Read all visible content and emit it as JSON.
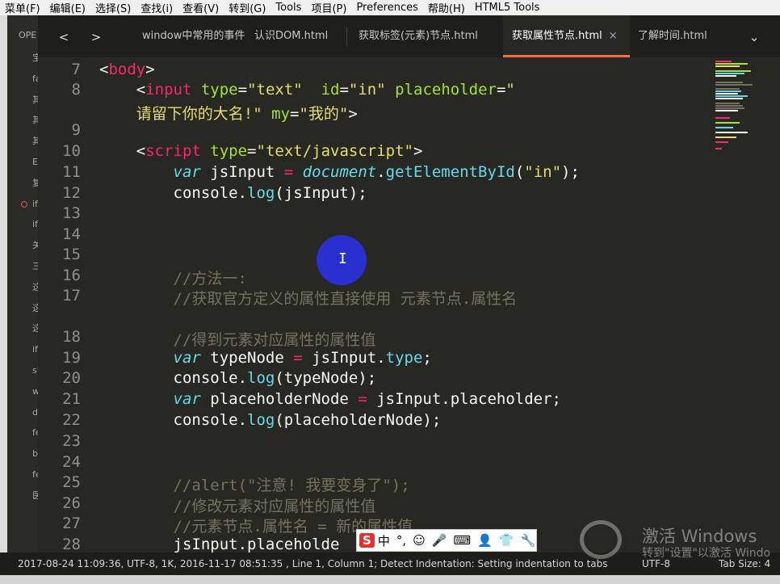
{
  "menu": [
    "菜单(F)",
    "编辑(E)",
    "选择(S)",
    "查找(i)",
    "查看(V)",
    "转到(G)",
    "Tools",
    "项目(P)",
    "Preferences",
    "帮助(H)",
    "HTML5 Tools"
  ],
  "sidebar": {
    "header": "OPE",
    "items": [
      "宝",
      "fa",
      "其",
      "其",
      "其",
      "El",
      "复",
      "if",
      "if",
      "关",
      "三",
      "这",
      "这",
      "这",
      "if",
      "s'",
      "w",
      "d",
      "fe",
      "b",
      "fe",
      "医"
    ]
  },
  "nav": {
    "back": "<",
    "forward": ">",
    "more": "⌄"
  },
  "tabs": [
    {
      "label": "window中常用的事件",
      "active": false
    },
    {
      "label": "认识DOM.html",
      "active": false
    },
    {
      "label": "获取标签(元素)节点.html",
      "active": false
    },
    {
      "label": "获取属性节点.html",
      "active": true,
      "close": "×"
    },
    {
      "label": "了解时间.html",
      "active": false
    }
  ],
  "code_lines": [
    {
      "n": "7",
      "segments": [
        {
          "t": "<",
          "c": "plain"
        },
        {
          "t": "body",
          "c": "tag"
        },
        {
          "t": ">",
          "c": "plain"
        }
      ]
    },
    {
      "n": "8",
      "segments": [
        {
          "t": "    <",
          "c": "plain"
        },
        {
          "t": "input",
          "c": "tag"
        },
        {
          "t": " type",
          "c": "attr"
        },
        {
          "t": "=",
          "c": "plain"
        },
        {
          "t": "\"text\"",
          "c": "str"
        },
        {
          "t": "  id",
          "c": "attr"
        },
        {
          "t": "=",
          "c": "plain"
        },
        {
          "t": "\"in\"",
          "c": "str"
        },
        {
          "t": " placeholder",
          "c": "attr"
        },
        {
          "t": "=",
          "c": "plain"
        },
        {
          "t": "\"",
          "c": "str"
        }
      ]
    },
    {
      "n": "",
      "segments": [
        {
          "t": "    请留下你的大名!\"",
          "c": "str"
        },
        {
          "t": " my",
          "c": "attr"
        },
        {
          "t": "=",
          "c": "plain"
        },
        {
          "t": "\"我的\"",
          "c": "str"
        },
        {
          "t": ">",
          "c": "plain"
        }
      ]
    },
    {
      "n": "9",
      "segments": []
    },
    {
      "n": "10",
      "segments": [
        {
          "t": "    <",
          "c": "plain"
        },
        {
          "t": "script",
          "c": "tag"
        },
        {
          "t": " type",
          "c": "attr"
        },
        {
          "t": "=",
          "c": "plain"
        },
        {
          "t": "\"text/javascript\"",
          "c": "str"
        },
        {
          "t": ">",
          "c": "plain"
        }
      ]
    },
    {
      "n": "11",
      "segments": [
        {
          "t": "        ",
          "c": "plain"
        },
        {
          "t": "var",
          "c": "kw"
        },
        {
          "t": " jsInput ",
          "c": "plain"
        },
        {
          "t": "=",
          "c": "tag"
        },
        {
          "t": " ",
          "c": "plain"
        },
        {
          "t": "document",
          "c": "kw"
        },
        {
          "t": ".",
          "c": "plain"
        },
        {
          "t": "getElementById",
          "c": "fn"
        },
        {
          "t": "(",
          "c": "plain"
        },
        {
          "t": "\"in\"",
          "c": "str"
        },
        {
          "t": ");",
          "c": "plain"
        }
      ]
    },
    {
      "n": "12",
      "segments": [
        {
          "t": "        console.",
          "c": "plain"
        },
        {
          "t": "log",
          "c": "fn"
        },
        {
          "t": "(jsInput);",
          "c": "plain"
        }
      ]
    },
    {
      "n": "13",
      "segments": []
    },
    {
      "n": "14",
      "segments": []
    },
    {
      "n": "15",
      "segments": []
    },
    {
      "n": "16",
      "segments": [
        {
          "t": "        //方法一:",
          "c": "cm"
        }
      ]
    },
    {
      "n": "17",
      "segments": [
        {
          "t": "        //获取官方定义的属性直接使用 元素节点.属性名",
          "c": "cm"
        }
      ]
    },
    {
      "n": "",
      "segments": []
    },
    {
      "n": "18",
      "segments": [
        {
          "t": "        //得到元素对应属性的属性值",
          "c": "cm"
        }
      ]
    },
    {
      "n": "19",
      "segments": [
        {
          "t": "        ",
          "c": "plain"
        },
        {
          "t": "var",
          "c": "kw"
        },
        {
          "t": " typeNode ",
          "c": "plain"
        },
        {
          "t": "=",
          "c": "tag"
        },
        {
          "t": " jsInput.",
          "c": "plain"
        },
        {
          "t": "type",
          "c": "fn"
        },
        {
          "t": ";",
          "c": "plain"
        }
      ]
    },
    {
      "n": "20",
      "segments": [
        {
          "t": "        console.",
          "c": "plain"
        },
        {
          "t": "log",
          "c": "fn"
        },
        {
          "t": "(typeNode);",
          "c": "plain"
        }
      ]
    },
    {
      "n": "21",
      "segments": [
        {
          "t": "        ",
          "c": "plain"
        },
        {
          "t": "var",
          "c": "kw"
        },
        {
          "t": " placeholderNode ",
          "c": "plain"
        },
        {
          "t": "=",
          "c": "tag"
        },
        {
          "t": " jsInput.placeholder;",
          "c": "plain"
        }
      ]
    },
    {
      "n": "22",
      "segments": [
        {
          "t": "        console.",
          "c": "plain"
        },
        {
          "t": "log",
          "c": "fn"
        },
        {
          "t": "(placeholderNode);",
          "c": "plain"
        }
      ]
    },
    {
      "n": "23",
      "segments": []
    },
    {
      "n": "24",
      "segments": []
    },
    {
      "n": "25",
      "segments": [
        {
          "t": "        //alert(\"注意! 我要变身了\");",
          "c": "cm"
        }
      ]
    },
    {
      "n": "26",
      "segments": [
        {
          "t": "        //修改元素对应属性的属性值",
          "c": "cm"
        }
      ]
    },
    {
      "n": "27",
      "segments": [
        {
          "t": "        //元素节点.属性名 = 新的属性值",
          "c": "cm"
        }
      ]
    },
    {
      "n": "28",
      "segments": [
        {
          "t": "        jsInput.placeholde",
          "c": "plain"
        }
      ]
    }
  ],
  "cursor_glyph": "I",
  "statusbar": {
    "left": "2017-08-24 11:09:36, UTF-8, 1K, 2016-11-17 08:51:35 , Line 1, Column 1; Detect Indentation: Setting indentation to tabs",
    "encoding": "UTF-8",
    "tab_size": "Tab Size: 4"
  },
  "ime": {
    "logo": "S",
    "items": [
      "中",
      "°,",
      "☺",
      "🎤",
      "⌨",
      "👤",
      "👕",
      "🔧"
    ]
  },
  "watermark": {
    "line1": "激活 Windows",
    "line2": "转到\"设置\"以激活 Windo"
  },
  "colors": {
    "bg": "#272822",
    "tag": "#f92672",
    "attr": "#a6e22e",
    "string": "#e6db74",
    "keyword": "#66d9ef",
    "comment": "#75715e",
    "tab_accent": "#f96a49"
  }
}
